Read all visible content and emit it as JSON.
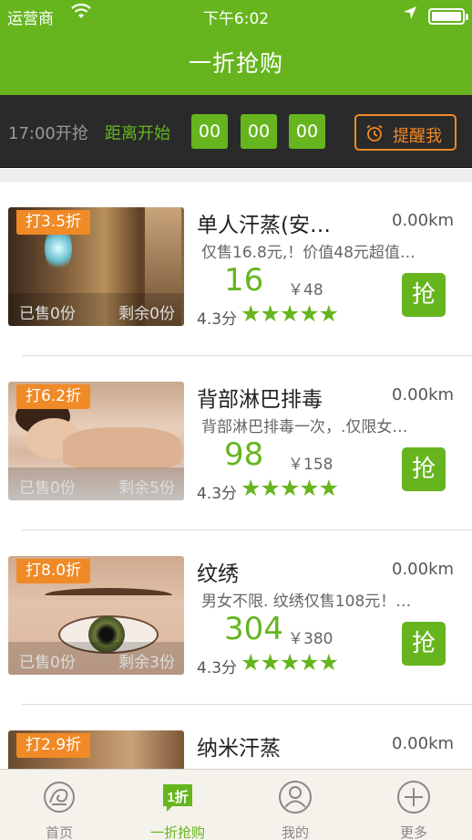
{
  "status_bar": {
    "carrier": "运营商",
    "time": "下午6:02"
  },
  "nav": {
    "title": "一折抢购"
  },
  "countdown": {
    "start_label": "17:00开抢",
    "distance_label": "距离开始",
    "hours": "00",
    "minutes": "00",
    "seconds": "00",
    "remind_label": "提醒我"
  },
  "items": [
    {
      "badge": "打3.5折",
      "title": "单人汗蒸(安…",
      "distance": "0.00km",
      "desc": "仅售16.8元,！价值48元超值…",
      "price": "16",
      "orig_price": "￥48",
      "score": "4.3分",
      "stars": "★★★★★",
      "sold": "已售0份",
      "remaining": "剩余0份",
      "grab_label": "抢"
    },
    {
      "badge": "打6.2折",
      "title": "背部淋巴排毒",
      "distance": "0.00km",
      "desc": "背部淋巴排毒一次，.仅限女…",
      "price": "98",
      "orig_price": "￥158",
      "score": "4.3分",
      "stars": "★★★★★",
      "sold": "已售0份",
      "remaining": "剩余5份",
      "grab_label": "抢"
    },
    {
      "badge": "打8.0折",
      "title": "纹绣",
      "distance": "0.00km",
      "desc": "男女不限. 纹绣仅售108元！…",
      "price": "304",
      "orig_price": "￥380",
      "score": "4.3分",
      "stars": "★★★★★",
      "sold": "已售0份",
      "remaining": "剩余3份",
      "grab_label": "抢"
    },
    {
      "badge": "打2.9折",
      "title": "纳米汗蒸",
      "distance": "0.00km",
      "desc": "",
      "price": "",
      "orig_price": "",
      "score": "",
      "stars": "",
      "sold": "",
      "remaining": "",
      "grab_label": ""
    }
  ],
  "tabs": [
    {
      "label": "首页",
      "icon": "home-icon"
    },
    {
      "label": "一折抢购",
      "icon": "one-discount-icon",
      "icon_text": "1折"
    },
    {
      "label": "我的",
      "icon": "user-icon"
    },
    {
      "label": "更多",
      "icon": "plus-circle-icon"
    }
  ],
  "colors": {
    "brand_green": "#66b51e",
    "accent_orange": "#f08a26",
    "dark_bar": "#2a2a2a"
  }
}
